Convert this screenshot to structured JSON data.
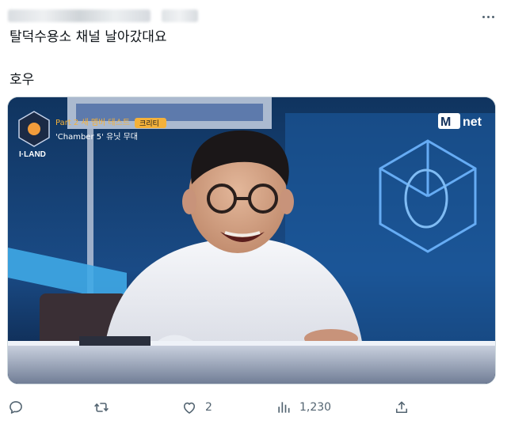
{
  "tweet": {
    "text_line1": "탈덕수용소 채널 날아갔대요",
    "text_line2": "호우"
  },
  "media": {
    "show_logo": "I·LAND",
    "caption_line1": "Part 2 새 멤버 테스트",
    "caption_badge": "크리티",
    "caption_line2": "'Chamber 5' 유닛 무대",
    "network_logo": "net",
    "network_logo_m": "M"
  },
  "actions": {
    "reply_icon": "reply-icon",
    "retweet_icon": "retweet-icon",
    "like_icon": "heart-icon",
    "like_count": "2",
    "views_icon": "views-icon",
    "views_count": "1,230",
    "share_icon": "share-icon"
  },
  "colors": {
    "text": "#0f1419",
    "secondary": "#536471",
    "media_bg": "#123a6c"
  }
}
